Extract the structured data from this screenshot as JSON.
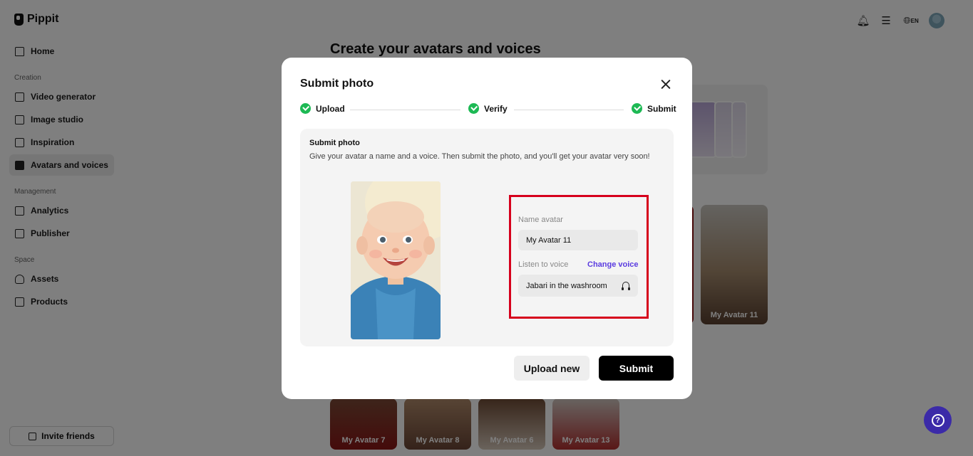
{
  "app": {
    "name": "Pippit"
  },
  "sidebar": {
    "items": [
      {
        "label": "Home"
      },
      {
        "label": "Video generator"
      },
      {
        "label": "Image studio"
      },
      {
        "label": "Inspiration"
      },
      {
        "label": "Avatars and voices"
      },
      {
        "label": "Analytics"
      },
      {
        "label": "Publisher"
      },
      {
        "label": "Assets"
      },
      {
        "label": "Products"
      }
    ],
    "sections": [
      "Creation",
      "Management",
      "Space"
    ],
    "invite_label": "Invite friends"
  },
  "topbar": {
    "language": "EN"
  },
  "page": {
    "title": "Create your avatars and voices",
    "avatar_cards": [
      {
        "label": "My Avatar 11"
      },
      {
        "label": "My Avatar 7"
      },
      {
        "label": "My Avatar 8"
      },
      {
        "label": "My Avatar 6"
      },
      {
        "label": "My Avatar 13"
      }
    ]
  },
  "modal": {
    "title": "Submit photo",
    "steps": [
      {
        "label": "Upload",
        "status": "complete"
      },
      {
        "label": "Verify",
        "status": "complete"
      },
      {
        "label": "Submit",
        "status": "complete"
      }
    ],
    "panel_title": "Submit photo",
    "panel_desc": "Give your avatar a name and a voice. Then submit the photo, and you'll get your avatar very soon!",
    "name_label": "Name avatar",
    "name_value": "My Avatar 11",
    "voice_label": "Listen to voice",
    "change_voice_label": "Change voice",
    "voice_value": "Jabari  in the washroom",
    "upload_new_label": "Upload new",
    "submit_label": "Submit"
  },
  "colors": {
    "accent": "#5a3be0",
    "success": "#1db954",
    "highlight": "#d6001c",
    "help": "#3b2aa8"
  }
}
